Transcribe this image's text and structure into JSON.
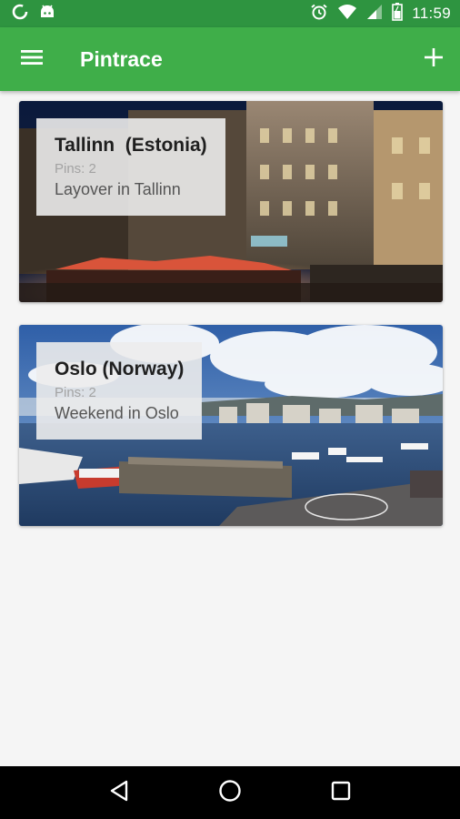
{
  "status_bar": {
    "time": "11:59",
    "left_icons": [
      "sync-icon",
      "android-icon"
    ],
    "right_icons": [
      "alarm-icon",
      "wifi-icon",
      "signal-icon",
      "battery-icon"
    ]
  },
  "app_bar": {
    "title": "Pintrace",
    "menu_icon": "menu-icon",
    "add_icon": "add-icon",
    "color": "#3fae49",
    "status_color": "#2e9440"
  },
  "trips": [
    {
      "title": "Tallinn  (Estonia)",
      "pins": "Pins: 2",
      "description": "Layover in Tallinn"
    },
    {
      "title": "Oslo (Norway)",
      "pins": "Pins: 2",
      "description": "Weekend in Oslo"
    }
  ],
  "nav_bar": {
    "icons": [
      "back-icon",
      "home-icon",
      "recents-icon"
    ]
  }
}
